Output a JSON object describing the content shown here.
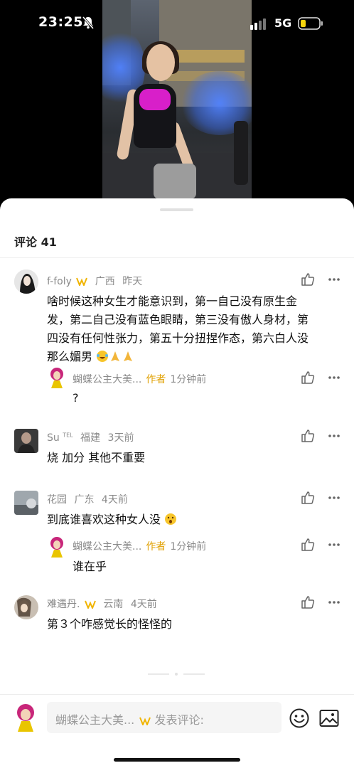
{
  "status_bar": {
    "time": "23:25",
    "network": "5G"
  },
  "sheet": {
    "title": "评论 41"
  },
  "comments": [
    {
      "name": "f-foly",
      "location": "广西",
      "time": "昨天",
      "text_lines": [
        "啥时候这种女生才能意识到，第一自己没有原生金",
        "发，第二自己没有蓝色眼睛，第三没有傲人身材，第",
        "四没有任何性张力，第五十分扭捏作态，第六白人没",
        "那么媚男"
      ],
      "reply": {
        "name": "蝴蝶公主大美...",
        "tag": "作者",
        "time": "1分钟前",
        "text": "?"
      }
    },
    {
      "name": "Su",
      "name_badge": "TEL",
      "location": "福建",
      "time": "3天前",
      "text": "烧 加分 其他不重要"
    },
    {
      "name": "花园",
      "location": "广东",
      "time": "4天前",
      "text": "到底谁喜欢这种女人没",
      "reply": {
        "name": "蝴蝶公主大美...",
        "tag": "作者",
        "time": "1分钟前",
        "text": "谁在乎"
      }
    },
    {
      "name": "难遇丹.",
      "location": "云南",
      "time": "4天前",
      "text": "第３个咋感觉长的怪怪的"
    }
  ],
  "input": {
    "placeholder_name": "蝴蝶公主大美...",
    "placeholder_text": "发表评论:"
  },
  "colors": {
    "author_tag": "#e0a000",
    "meta": "#8a8a8a",
    "vip": "#f0b400"
  }
}
